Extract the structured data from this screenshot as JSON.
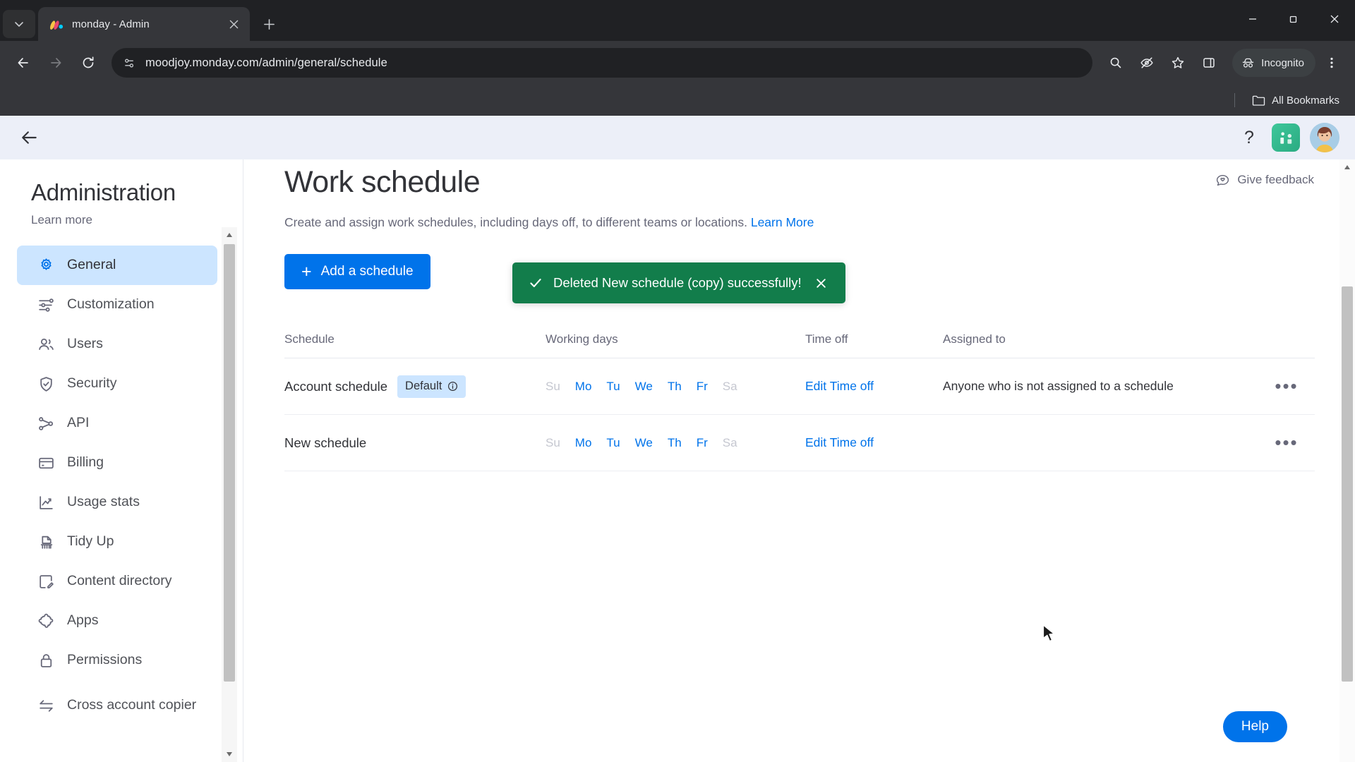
{
  "browser": {
    "tab": {
      "title": "monday - Admin",
      "favicon": "monday-logo-icon"
    },
    "new_tab_label": "+",
    "url": "moodjoy.monday.com/admin/general/schedule",
    "toolbar_icons": [
      "back-icon",
      "forward-icon",
      "reload-icon",
      "site-info-icon",
      "zoom-icon",
      "incognito-eye-icon",
      "bookmark-star-icon",
      "side-panel-icon",
      "chrome-menu-icon"
    ],
    "profile_label": "Incognito",
    "bookmarks_label": "All Bookmarks",
    "window_controls": [
      "minimize",
      "maximize",
      "close"
    ]
  },
  "app": {
    "back_label": "Back",
    "help_label": "?",
    "app_switcher_label": "apps",
    "avatar_label": "user avatar",
    "give_feedback": "Give feedback",
    "help_fab": "Help"
  },
  "sidebar": {
    "title": "Administration",
    "learn_more": "Learn more",
    "items": [
      {
        "label": "General",
        "icon": "gear-icon",
        "active": true
      },
      {
        "label": "Customization",
        "icon": "sliders-icon",
        "active": false
      },
      {
        "label": "Users",
        "icon": "users-icon",
        "active": false
      },
      {
        "label": "Security",
        "icon": "shield-check-icon",
        "active": false
      },
      {
        "label": "API",
        "icon": "api-nodes-icon",
        "active": false
      },
      {
        "label": "Billing",
        "icon": "credit-card-icon",
        "active": false
      },
      {
        "label": "Usage stats",
        "icon": "chart-line-icon",
        "active": false
      },
      {
        "label": "Tidy Up",
        "icon": "broom-icon",
        "active": false
      },
      {
        "label": "Content directory",
        "icon": "content-edit-icon",
        "active": false
      },
      {
        "label": "Apps",
        "icon": "puzzle-icon",
        "active": false
      },
      {
        "label": "Permissions",
        "icon": "lock-icon",
        "active": false
      },
      {
        "label": "Cross account copier",
        "icon": "transfer-arrows-icon",
        "active": false
      }
    ]
  },
  "main": {
    "title": "Work schedule",
    "description": "Create and assign work schedules, including days off, to different teams or locations.",
    "learn_more": "Learn More",
    "add_button": "Add a schedule",
    "add_button_icon": "plus-icon",
    "table": {
      "headers": [
        "Schedule",
        "Working days",
        "Time off",
        "Assigned to"
      ],
      "rows": [
        {
          "schedule": "Account schedule",
          "badge": "Default",
          "badge_icon": "info-icon",
          "days": [
            {
              "label": "Su",
              "on": false
            },
            {
              "label": "Mo",
              "on": true
            },
            {
              "label": "Tu",
              "on": true
            },
            {
              "label": "We",
              "on": true
            },
            {
              "label": "Th",
              "on": true
            },
            {
              "label": "Fr",
              "on": true
            },
            {
              "label": "Sa",
              "on": false
            }
          ],
          "time_off": "Edit Time off",
          "assigned_to": "Anyone who is not assigned to a schedule",
          "menu": "•••"
        },
        {
          "schedule": "New schedule",
          "badge": "",
          "badge_icon": "",
          "days": [
            {
              "label": "Su",
              "on": false
            },
            {
              "label": "Mo",
              "on": true
            },
            {
              "label": "Tu",
              "on": true
            },
            {
              "label": "We",
              "on": true
            },
            {
              "label": "Th",
              "on": true
            },
            {
              "label": "Fr",
              "on": true
            },
            {
              "label": "Sa",
              "on": false
            }
          ],
          "time_off": "Edit Time off",
          "assigned_to": "",
          "menu": "•••"
        }
      ]
    }
  },
  "toast": {
    "message": "Deleted New schedule (copy) successfully!",
    "status_icon": "check-icon",
    "close_icon": "close-icon",
    "color": "#127d4b"
  },
  "colors": {
    "accent": "#0073ea",
    "badge_bg": "#cce5ff",
    "toast_green": "#127d4b",
    "text_primary": "#323338",
    "text_secondary": "#676879",
    "chrome_dark": "#202124",
    "chrome_toolbar": "#35363a"
  }
}
